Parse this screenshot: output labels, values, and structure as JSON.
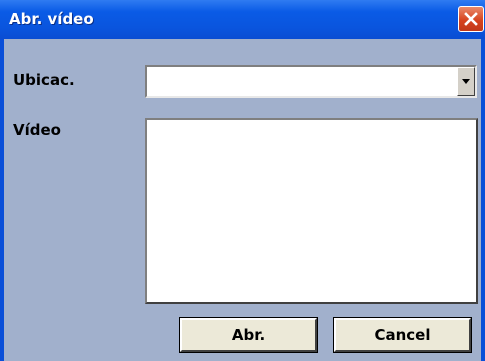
{
  "window": {
    "title": "Abr. vídeo",
    "close_icon": "close-icon"
  },
  "form": {
    "location_label": "Ubicac.",
    "location_value": "",
    "video_label": "Vídeo",
    "video_items": []
  },
  "buttons": {
    "open_label": "Abr.",
    "cancel_label": "Cancel"
  },
  "colors": {
    "titlebar": "#0a55de",
    "client_bg": "#a1b0cc",
    "close_button": "#d7441f"
  }
}
